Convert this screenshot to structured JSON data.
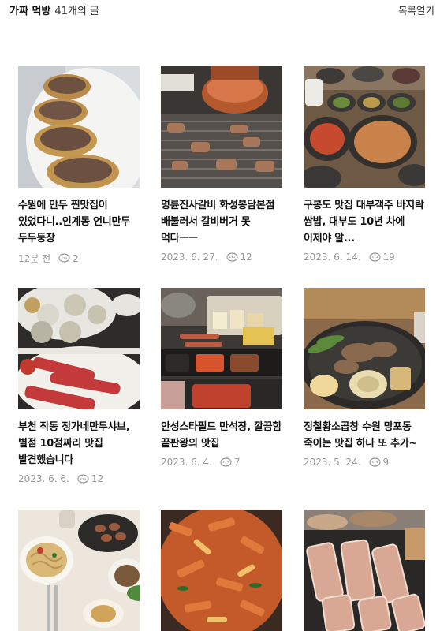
{
  "header": {
    "category": "가짜 먹방",
    "count": "41개의 글",
    "toggle_label": "목록열기"
  },
  "posts": [
    {
      "title": "수원에 만두 찐맛집이 있었다니..인계동 언니만두 두두둥장",
      "date": "12분 전",
      "comments": "2",
      "image": "dumplings-photo"
    },
    {
      "title": "명륜진사갈비 화성봉담본점 배불러서 갈비버거 못 먹다ㅡㅡ",
      "date": "2023. 6. 27.",
      "comments": "12",
      "image": "grill-photo"
    },
    {
      "title": "구봉도 맛집 대부객주 바지락 쌈밥, 대부도 10년 차에 이제야 알...",
      "date": "2023. 6. 14.",
      "comments": "19",
      "image": "side-dishes-photo"
    },
    {
      "title": "부천 작동 정가네만두샤브, 별점 10점짜리 맛집 발견했습니다",
      "date": "2023. 6. 6.",
      "comments": "12",
      "image": "shabu-photo"
    },
    {
      "title": "안성스타필드 만석장, 깔끔함 끝판왕의 맛집",
      "date": "2023. 6. 4.",
      "comments": "7",
      "image": "meal-set-photo"
    },
    {
      "title": "정철황소곱창 수원 망포동 죽이는 맛집 하나 또 추가~",
      "date": "2023. 5. 24.",
      "comments": "9",
      "image": "gopchang-photo"
    },
    {
      "title": "",
      "date": "",
      "comments": "",
      "image": "pasta-photo"
    },
    {
      "title": "",
      "date": "",
      "comments": "",
      "image": "spicy-stirfry-photo"
    },
    {
      "title": "",
      "date": "",
      "comments": "",
      "image": "pork-belly-photo"
    }
  ]
}
